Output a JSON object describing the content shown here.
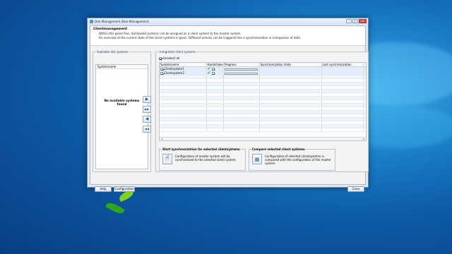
{
  "window": {
    "title": "Disk Management (Disk Management)",
    "controls": {
      "minimize": "–",
      "maximize": "□",
      "close": "✕"
    }
  },
  "header": {
    "title": "Clientmanagement",
    "description_line1": "Within this panel free, distributed systems can be assigned as a client system to the master system.",
    "description_line2": "An overview of the current state of the client systems is given. Different actions can be triggered like a synchronization or comparison of data."
  },
  "left_panel": {
    "label": "Available dist systems",
    "column_header": "Systemname",
    "empty_message": "No available systems found"
  },
  "arrow_buttons": [
    {
      "icon": "arrow-right-icon",
      "glyph": "▶"
    },
    {
      "icon": "double-arrow-right-icon",
      "glyph": "▶▶"
    },
    {
      "icon": "arrow-left-icon",
      "glyph": "◀"
    },
    {
      "icon": "double-arrow-left-icon",
      "glyph": "◀◀"
    }
  ],
  "right_panel": {
    "label": "Integrated client systems",
    "unselect_all": "Unselect all",
    "columns": [
      "Systemname",
      "Handshake",
      "Progress",
      "Synchronization state",
      "Last synchronization"
    ],
    "rows": [
      {
        "name": "Clientsystem1",
        "handshake": "✔",
        "sync_state": "",
        "last_sync": ""
      },
      {
        "name": "Clientsystem2",
        "handshake": "✔",
        "sync_state": "",
        "last_sync": ""
      }
    ]
  },
  "actions": {
    "sync": {
      "title": "Start synchronization for selected clientsystems",
      "text": "Configuration of master system will be synchronized to the selected client system"
    },
    "compare": {
      "title": "Compare selected client systems",
      "text": "Configuration of selected clientsystems is compared with the configuration of the master system"
    }
  },
  "footer": {
    "help": "Help",
    "configuration": "Configuration",
    "close": "Close"
  },
  "colors": {
    "desktop": "#0d5aa6",
    "window_bg": "#dde8f3",
    "accent": "#1f5ea8",
    "check_green": "#2c9c2c",
    "highlight": "#f7e37a"
  }
}
